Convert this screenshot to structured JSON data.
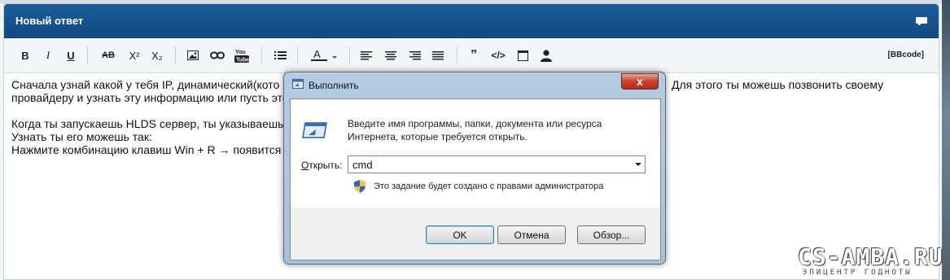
{
  "editor": {
    "title": "Новый ответ",
    "bbcode_label": "[BBcode]",
    "toolbar": {
      "bold": "B",
      "italic": "I",
      "underline": "U",
      "strike": "AB",
      "superscript": "X²",
      "subscript": "X₂",
      "quote": "”",
      "code": "</>"
    },
    "lines": [
      "Сначала узнай какой у тебя IP, динамический(кото",
      "провайдеру и узнать эту информацию или пусть это",
      "",
      "Когда ты запускаешь HLDS сервер, ты указываешь",
      "Узнать ты его можешь так:",
      "Нажмите комбинацию клавиш Win + R → появится"
    ],
    "line_tail_1": "Для этого ты можешь позвонить своему"
  },
  "run_dialog": {
    "title": "Выполнить",
    "close": "x",
    "description_line1": "Введите имя программы, папки, документа или ресурса",
    "description_line2": "Интернета, которые требуется открыть.",
    "open_label_prefix": "О",
    "open_label_rest": "ткрыть:",
    "input_value": "cmd",
    "admin_note": "Это задание будет создано с правами администратора",
    "ok": "OK",
    "cancel": "Отмена",
    "browse": "Обзор..."
  },
  "watermark": {
    "main": "CS-AMBA.RU",
    "sub": "ЭПИЦЕНТР ГОДНОТЫ"
  }
}
